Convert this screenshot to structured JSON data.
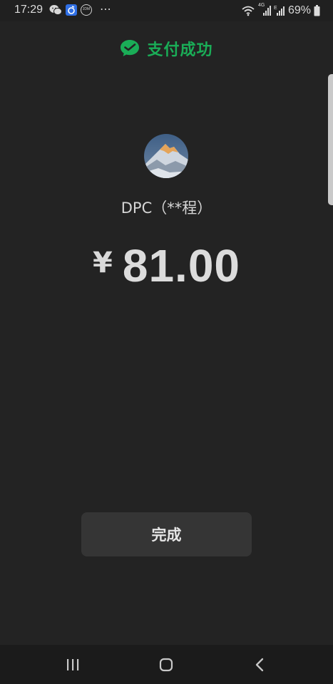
{
  "status_bar": {
    "time": "17:29",
    "network_label": "4G",
    "battery_percent": "69%",
    "icons": [
      "wechat-icon",
      "app-blue-icon",
      "jdm-icon",
      "more-dots-icon",
      "wifi-icon",
      "signal-4g-icon",
      "signal-e-icon",
      "battery-icon"
    ]
  },
  "header": {
    "icon": "wechat-pay-icon",
    "title": "支付成功",
    "accent_color": "#1aad57"
  },
  "payment": {
    "merchant_name": "DPC（**程）",
    "currency_symbol": "¥",
    "amount": "81.00"
  },
  "actions": {
    "done_label": "完成"
  },
  "nav_bar": {
    "recents": "recents-icon",
    "home": "home-icon",
    "back": "back-icon"
  }
}
